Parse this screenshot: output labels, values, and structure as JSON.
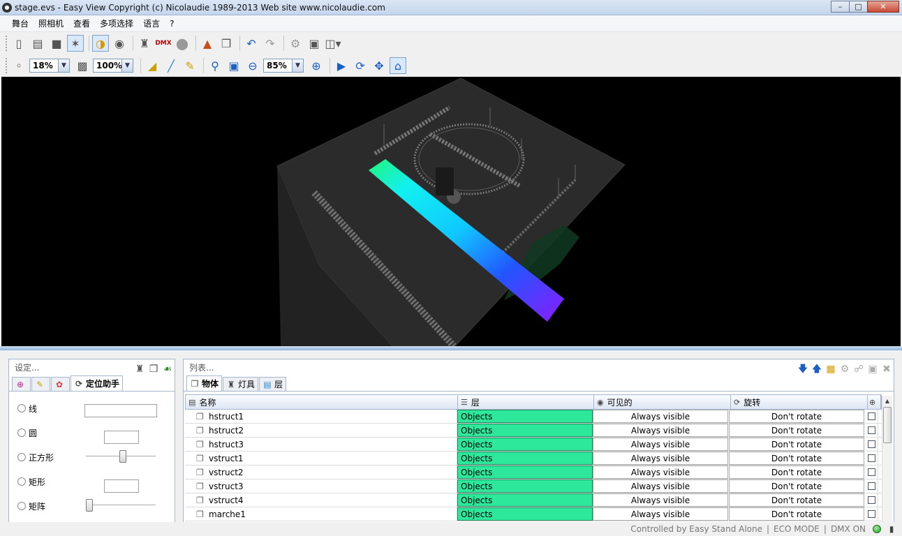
{
  "window": {
    "title": "stage.evs - Easy View   Copyright (c) Nicolaudie 1989-2013    Web site www.nicolaudie.com",
    "buttons": {
      "minimize": "–",
      "maximize": "□",
      "close": "✕"
    }
  },
  "menu": [
    "舞台",
    "照相机",
    "查看",
    "多项选择",
    "语言",
    "?"
  ],
  "toolbar2": {
    "zoom1": "18%",
    "zoom2": "100%",
    "zoom3": "85%"
  },
  "left_panel": {
    "title": "设定...",
    "tab_active": "定位助手",
    "options": [
      "线",
      "圆",
      "正方形",
      "矩形",
      "矩阵"
    ]
  },
  "right_panel": {
    "title": "列表...",
    "tabs": [
      "物体",
      "灯具",
      "层"
    ],
    "columns": [
      "名称",
      "层",
      "可见的",
      "旋转"
    ],
    "rows": [
      {
        "name": "hstruct1",
        "layer": "Objects",
        "visible": "Always visible",
        "rotate": "Don't rotate"
      },
      {
        "name": "hstruct2",
        "layer": "Objects",
        "visible": "Always visible",
        "rotate": "Don't rotate"
      },
      {
        "name": "hstruct3",
        "layer": "Objects",
        "visible": "Always visible",
        "rotate": "Don't rotate"
      },
      {
        "name": "vstruct1",
        "layer": "Objects",
        "visible": "Always visible",
        "rotate": "Don't rotate"
      },
      {
        "name": "vstruct2",
        "layer": "Objects",
        "visible": "Always visible",
        "rotate": "Don't rotate"
      },
      {
        "name": "vstruct3",
        "layer": "Objects",
        "visible": "Always visible",
        "rotate": "Don't rotate"
      },
      {
        "name": "vstruct4",
        "layer": "Objects",
        "visible": "Always visible",
        "rotate": "Don't rotate"
      },
      {
        "name": "marche1",
        "layer": "Objects",
        "visible": "Always visible",
        "rotate": "Don't rotate"
      }
    ]
  },
  "statusbar": {
    "controlled": "Controlled by Easy Stand Alone",
    "eco": "ECO MODE",
    "dmx": "DMX ON"
  },
  "colors": {
    "layer_cell": "#2de89b",
    "viewport_bg": "#000000",
    "led": "#1c9a1c"
  }
}
